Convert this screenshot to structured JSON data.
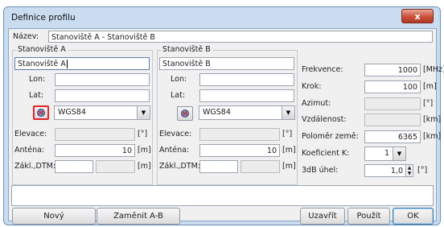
{
  "window": {
    "title": "Definice profilu",
    "close_glyph": "x"
  },
  "name": {
    "label": "Název:",
    "value": "Stanoviště A - Stanoviště B"
  },
  "station_a": {
    "title": "Stanoviště A",
    "name_value": "Stanoviště A",
    "lon_label": "Lon:",
    "lon_value": "",
    "lat_label": "Lat:",
    "lat_value": "",
    "datum_value": "WGS84",
    "elevation_label": "Elevace:",
    "elevation_value": "",
    "elevation_unit": "[°]",
    "antenna_label": "Anténa:",
    "antenna_value": "10",
    "antenna_unit": "[m]",
    "dtm_label": "Zákl.,DTM:",
    "dtm_value": "",
    "dtm_value2": "",
    "dtm_unit": "[m]"
  },
  "station_b": {
    "title": "Stanoviště B",
    "name_value": "Stanoviště B",
    "lon_label": "Lon:",
    "lon_value": "",
    "lat_label": "Lat:",
    "lat_value": "",
    "datum_value": "WGS84",
    "elevation_label": "Elevace:",
    "elevation_value": "",
    "elevation_unit": "[°]",
    "antenna_label": "Anténa:",
    "antenna_value": "10",
    "antenna_unit": "[m]",
    "dtm_label": "Zákl.,DTM:",
    "dtm_value": "",
    "dtm_value2": "",
    "dtm_unit": "[m]"
  },
  "params": {
    "frequency_label": "Frekvence:",
    "frequency_value": "1000",
    "frequency_unit": "[MHz]",
    "step_label": "Krok:",
    "step_value": "100",
    "step_unit": "[m]",
    "azimuth_label": "Azimut:",
    "azimuth_value": "",
    "azimuth_unit": "[°]",
    "distance_label": "Vzdálenost:",
    "distance_value": "",
    "distance_unit": "[km]",
    "earth_radius_label": "Poloměr země:",
    "earth_radius_value": "6365",
    "earth_radius_unit": "[km]",
    "k_label": "Koeficient K:",
    "k_value": "1",
    "beamwidth_label": "3dB úhel:",
    "beamwidth_value": "1,0",
    "beamwidth_unit": "[°]"
  },
  "notes": {
    "value": ""
  },
  "buttons": {
    "new": "Nový",
    "swap": "Zaměnit A-B",
    "close": "Uzavřít",
    "apply": "Použít",
    "ok": "OK"
  },
  "icons": {
    "map_pick": "map-pick-icon",
    "dropdown": "chevron-down-icon",
    "spin": "spin-arrows-icon"
  },
  "colors": {
    "frame": "#c9dcf0",
    "close_button": "#c9503a",
    "highlight": "#e0252a"
  }
}
